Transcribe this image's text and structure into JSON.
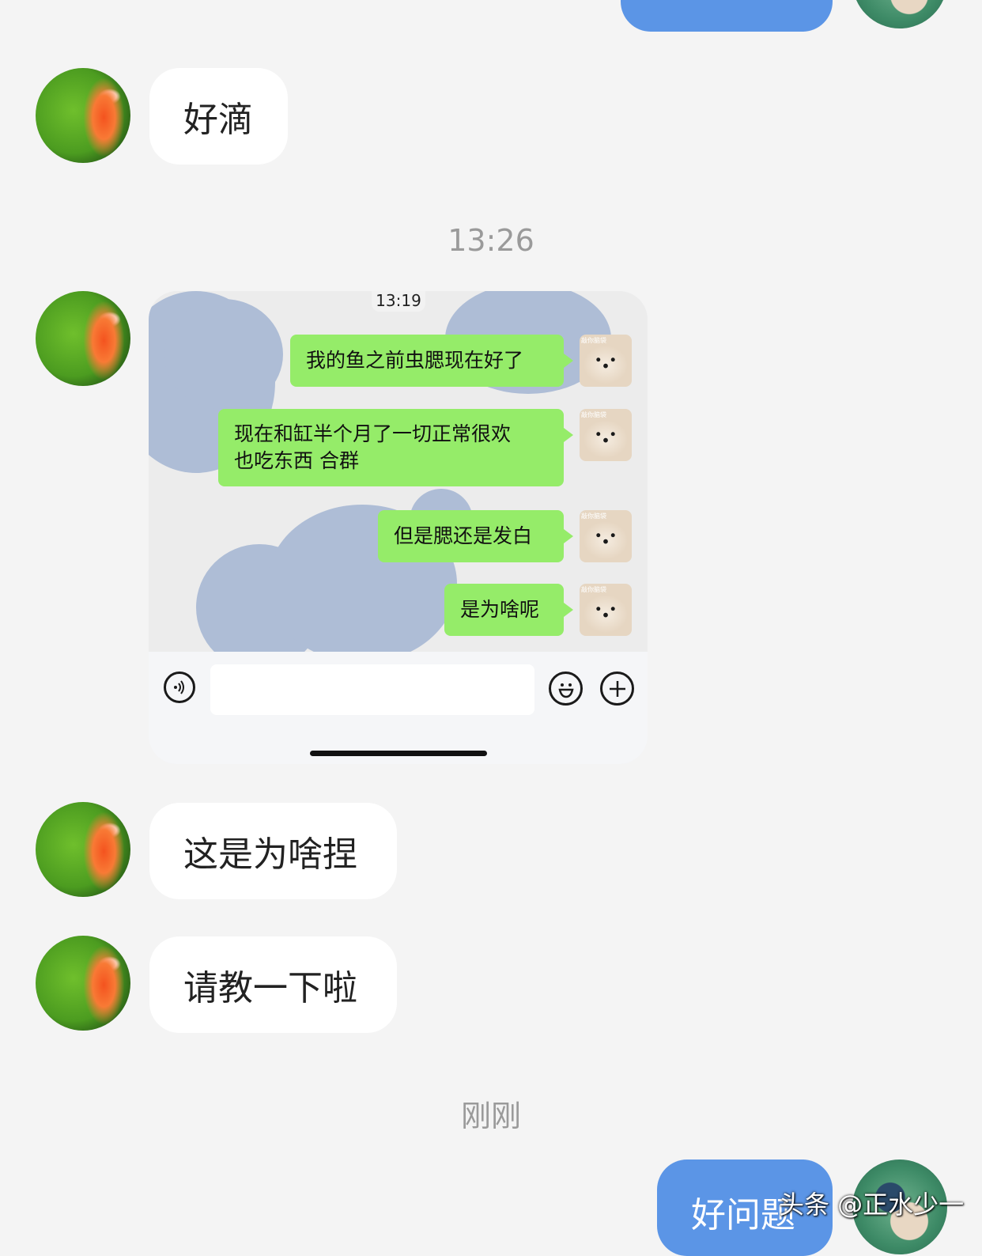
{
  "messages": {
    "top_out_partial": "",
    "msg1": "好滴",
    "time1": "13:26",
    "msg3": "这是为啥捏",
    "msg4": "请教一下啦",
    "time2": "刚刚",
    "msg_out_last": "好问题"
  },
  "embedded_screenshot": {
    "time": "13:19",
    "sticker_label": "敲你脑袋",
    "bubbles": [
      "我的鱼之前虫腮现在好了",
      "现在和缸半个月了一切正常很欢",
      "也吃东西 合群",
      "但是腮还是发白",
      "是为啥呢"
    ]
  },
  "watermark": "头条 @正水少一",
  "colors": {
    "background": "#f4f4f4",
    "incoming_bubble": "#ffffff",
    "outgoing_bubble": "#5b95e6",
    "wechat_green": "#95ec69"
  }
}
